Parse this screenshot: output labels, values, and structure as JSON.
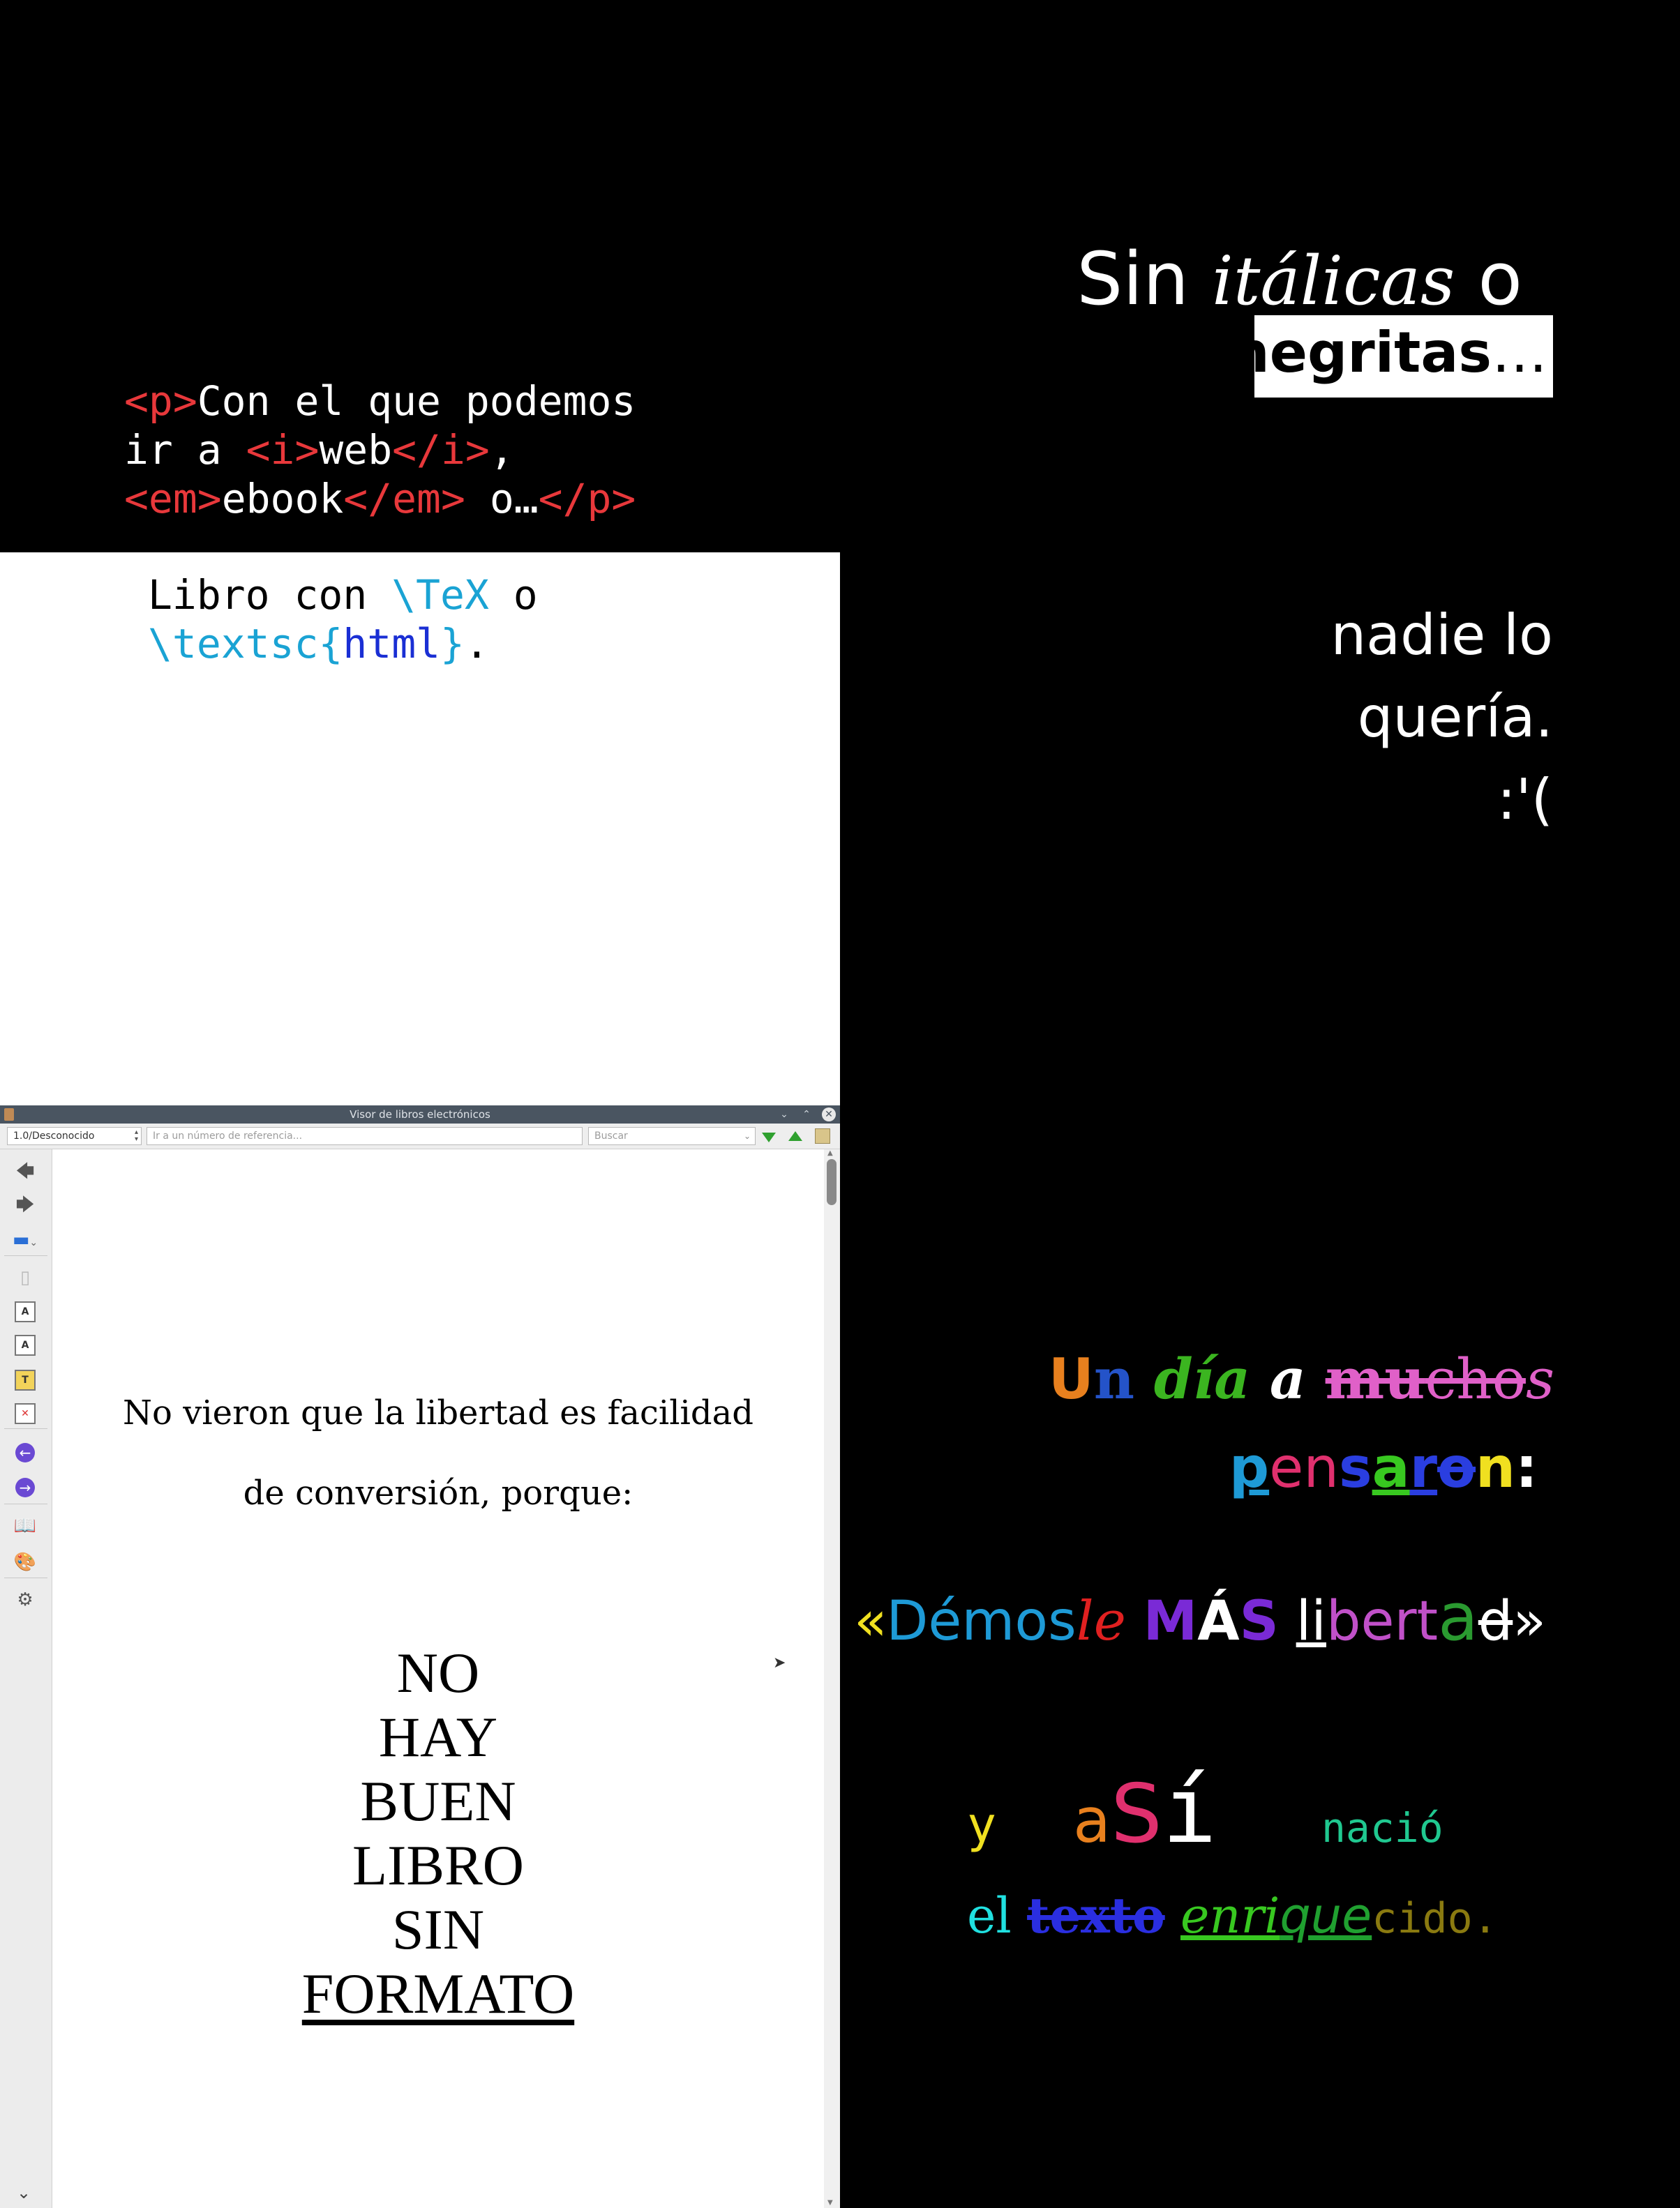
{
  "top_left": {
    "line1": {
      "open_p": "<p>",
      "text": "Con el que podemos"
    },
    "line2": {
      "pre": "ir a ",
      "open_i": "<i>",
      "word": "web",
      "close_i": "</i>",
      "post": ","
    },
    "line3": {
      "open_em": "<em>",
      "word": "ebook",
      "close_em": "</em>",
      "post": " o…",
      "close_p": "</p>"
    }
  },
  "top_right": {
    "sin": "Sin",
    "italicas": "itálicas",
    "o": "o",
    "negritas": "negritas",
    "ellipsis": "…"
  },
  "tex_panel": {
    "l1_a": "Libro con ",
    "l1_cmd": "\\TeX",
    "l1_b": " o",
    "l2_cmd": "\\textsc",
    "l2_lb": "{",
    "l2_arg": "html",
    "l2_rb": "}",
    "l2_dot": "."
  },
  "right_middle": {
    "line1": "nadie lo",
    "line2": "quería.",
    "line3": ":'("
  },
  "viewer": {
    "title": "Visor de libros electrónicos",
    "page_select": "1.0/Desconocido",
    "ref_placeholder": "Ir a un número de referencia...",
    "search_placeholder": "Buscar",
    "sentence_1": "No vieron que la libertad es facilidad",
    "sentence_2": "de conversión, porque:",
    "big_words": [
      "NO",
      "HAY",
      "BUEN",
      "LIBRO",
      "SIN",
      "FORMATO"
    ]
  },
  "right_bottom": {
    "un": "U",
    "un2": "n",
    "dia": "día",
    "a": "a",
    "mu": "mu",
    "cho": "cho",
    "s": "s",
    "pensaron": [
      "p",
      "e",
      "n",
      "s",
      "a",
      "r",
      "o",
      "n",
      ":"
    ],
    "demosle": {
      "q_open": "«",
      "demos": "Démos",
      "le": "le",
      "mas1": "M",
      "mas2": "Á",
      "mas3": "S",
      "li": "li",
      "bert": "bert",
      "a": "a",
      "d": "d",
      "q_close": "»"
    },
    "asi": {
      "y": "y",
      "a": "a",
      "s": "S",
      "i": "í",
      "nacio": "nació"
    },
    "texto": {
      "el": "el",
      "texto": "texto",
      "enri": "enri",
      "que": "que",
      "cido": "cido."
    }
  },
  "colors": {
    "tag_red": "#e8383b",
    "tex_cyan": "#1aa3d4",
    "tex_blue": "#1a2fd4"
  }
}
